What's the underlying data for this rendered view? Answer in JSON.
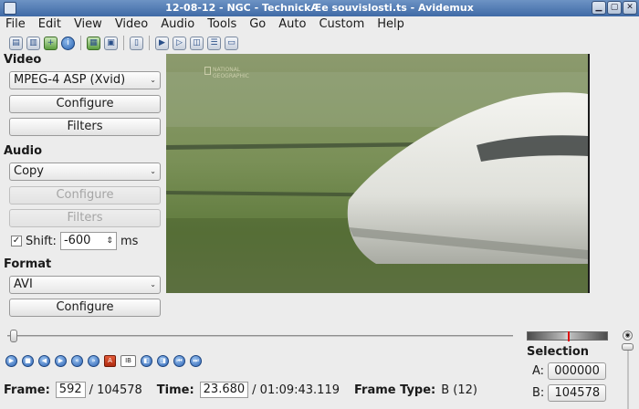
{
  "window": {
    "title": "12-08-12 - NGC - TechnickÆe souvislosti.ts - Avidemux"
  },
  "menu": [
    "File",
    "Edit",
    "View",
    "Video",
    "Audio",
    "Tools",
    "Go",
    "Auto",
    "Custom",
    "Help"
  ],
  "sidebar": {
    "video_label": "Video",
    "video_codec": "MPEG-4 ASP (Xvid)",
    "video_configure": "Configure",
    "video_filters": "Filters",
    "audio_label": "Audio",
    "audio_codec": "Copy",
    "audio_configure": "Configure",
    "audio_filters": "Filters",
    "shift_label": "Shift:",
    "shift_value": "-600",
    "shift_unit": "ms",
    "format_label": "Format",
    "format_value": "AVI",
    "format_configure": "Configure"
  },
  "video_overlay": {
    "logo_line1": "NATIONAL",
    "logo_line2": "GEOGRAPHIC"
  },
  "status": {
    "frame_label": "Frame:",
    "frame_value": "592",
    "frame_total": "/ 104578",
    "time_label": "Time:",
    "time_value": "23.680",
    "time_total": "/ 01:09:43.119",
    "frame_type_label": "Frame Type:",
    "frame_type_value": "B (12)"
  },
  "selection": {
    "label": "Selection",
    "a_label": "A:",
    "a_value": "000000",
    "b_label": "B:",
    "b_value": "104578"
  },
  "playback": {
    "position_fraction": 0.0057
  },
  "colors": {
    "titlebar": "#3f6aa6",
    "accent_blue": "#2c62b2",
    "background": "#ececec"
  }
}
